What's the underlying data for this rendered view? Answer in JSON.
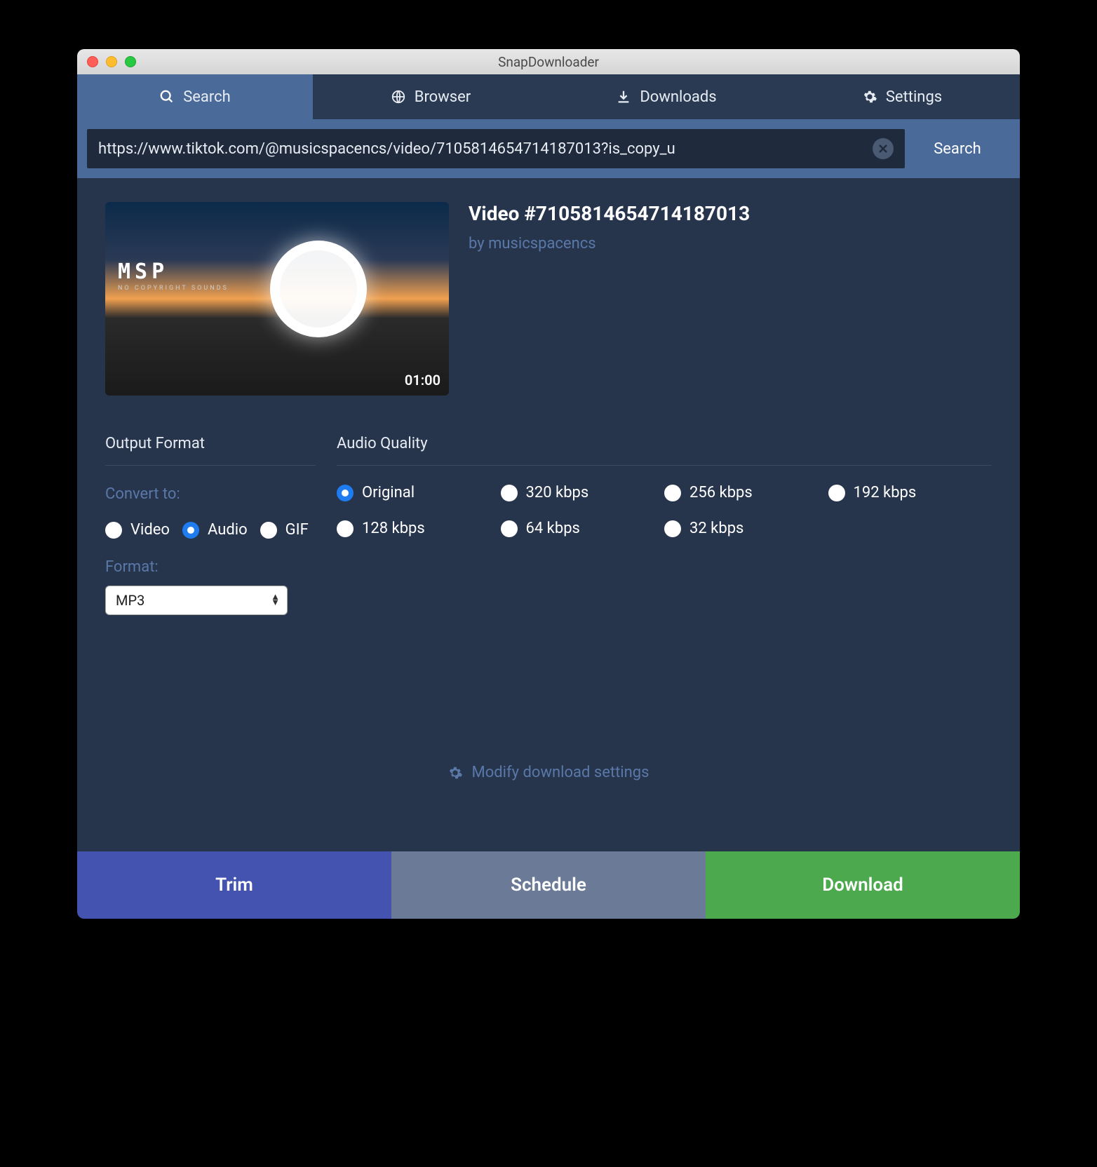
{
  "window": {
    "title": "SnapDownloader"
  },
  "tabs": {
    "search": "Search",
    "browser": "Browser",
    "downloads": "Downloads",
    "settings": "Settings",
    "active": "search"
  },
  "searchbar": {
    "url": "https://www.tiktok.com/@musicspacencs/video/7105814654714187013?is_copy_u",
    "button": "Search"
  },
  "video": {
    "title": "Video #7105814654714187013",
    "author": "by musicspacencs",
    "duration": "01:00",
    "thumb_logo": "MSP",
    "thumb_sub": "NO COPYRIGHT SOUNDS"
  },
  "output": {
    "title": "Output Format",
    "convert_label": "Convert to:",
    "options": {
      "video": "Video",
      "audio": "Audio",
      "gif": "GIF"
    },
    "selected": "audio",
    "format_label": "Format:",
    "format_value": "MP3"
  },
  "quality": {
    "title": "Audio Quality",
    "options": [
      "Original",
      "320 kbps",
      "256 kbps",
      "192 kbps",
      "128 kbps",
      "64 kbps",
      "32 kbps"
    ],
    "selected": "Original"
  },
  "modify": "Modify download settings",
  "buttons": {
    "trim": "Trim",
    "schedule": "Schedule",
    "download": "Download"
  }
}
